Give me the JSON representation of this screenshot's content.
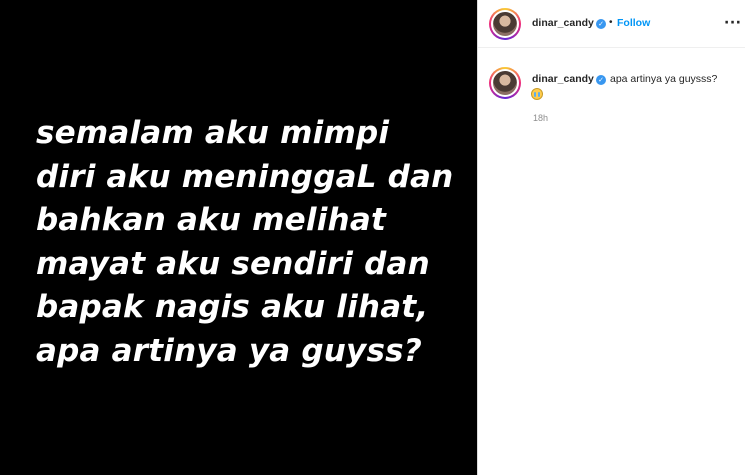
{
  "post": {
    "image_text": "semalam aku mimpi\ndiri aku meninggaL dan\nbahkan aku melihat\nmayat aku sendiri dan\nbapak nagis aku lihat,\napa artinya ya guyss?",
    "background_color": "#000000"
  },
  "header": {
    "username": "dinar_candy",
    "verified_icon": "verified-badge-icon",
    "separator": "•",
    "follow_label": "Follow",
    "more_icon": "more-options-icon",
    "more_glyph": "···"
  },
  "caption": {
    "username": "dinar_candy",
    "text": "apa artinya ya guysss?",
    "emoji": "crying-face-icon",
    "timestamp": "18h"
  },
  "colors": {
    "follow": "#0095f6",
    "verified": "#3897f0"
  }
}
